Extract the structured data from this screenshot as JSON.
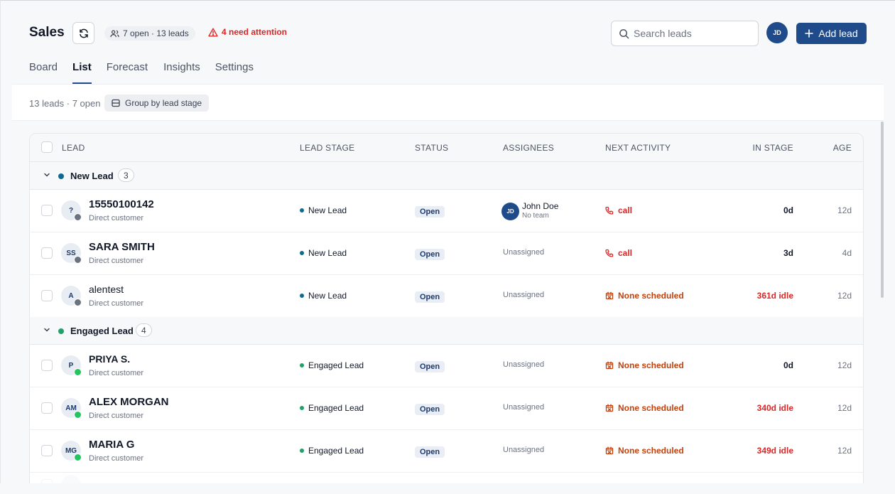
{
  "header": {
    "title": "Sales",
    "pill_text": "7 open · 13 leads",
    "attention_text": "4 need attention",
    "search_placeholder": "Search leads",
    "avatar_initials": "JD",
    "add_button_label": "Add lead"
  },
  "tabs": [
    {
      "label": "Board",
      "active": false
    },
    {
      "label": "List",
      "active": true
    },
    {
      "label": "Forecast",
      "active": false
    },
    {
      "label": "Insights",
      "active": false
    },
    {
      "label": "Settings",
      "active": false
    }
  ],
  "toolbar": {
    "count_text": "13 leads · 7 open",
    "group_label": "Group by lead stage"
  },
  "table": {
    "columns": [
      "LEAD",
      "LEAD STAGE",
      "STATUS",
      "ASSIGNEES",
      "NEXT ACTIVITY",
      "IN STAGE",
      "AGE"
    ],
    "groups": [
      {
        "name": "New Lead",
        "count": "3",
        "color": "#0e6b8f",
        "rows": [
          {
            "initials": "?",
            "name": "15550100142",
            "sub": "Direct customer",
            "source": "web",
            "stage": "New Lead",
            "status": "Open",
            "assignee_initials": "JD",
            "assignee_name": "John Doe",
            "assignee_team": "No team",
            "activity": "call",
            "activity_type": "call",
            "in_stage": "0d",
            "age": "12d"
          },
          {
            "initials": "SS",
            "name": "SARA SMITH",
            "sub": "Direct customer",
            "source": "web",
            "stage": "New Lead",
            "status": "Open",
            "assignee": "Unassigned",
            "activity": "call",
            "activity_type": "call",
            "in_stage": "3d",
            "age": "4d"
          },
          {
            "initials": "A",
            "name": "alentest",
            "sub": "Direct customer",
            "source": "web",
            "stage": "New Lead",
            "status": "Open",
            "assignee": "Unassigned",
            "activity": "None scheduled",
            "activity_type": "none",
            "in_stage": "361d idle",
            "age": "12d"
          }
        ]
      },
      {
        "name": "Engaged Lead",
        "count": "4",
        "color": "#22a06b",
        "rows": [
          {
            "initials": "P",
            "name": "PRIYA S.",
            "sub": "Direct customer",
            "source": "wa",
            "stage": "Engaged Lead",
            "status": "Open",
            "assignee": "Unassigned",
            "activity": "None scheduled",
            "activity_type": "none",
            "in_stage": "0d",
            "age": "12d"
          },
          {
            "initials": "AM",
            "name": "ALEX MORGAN",
            "sub": "Direct customer",
            "source": "wa",
            "stage": "Engaged Lead",
            "status": "Open",
            "assignee": "Unassigned",
            "activity": "None scheduled",
            "activity_type": "none",
            "in_stage": "340d idle",
            "age": "12d"
          },
          {
            "initials": "MG",
            "name": "MARIA G",
            "sub": "Direct customer",
            "source": "wa",
            "stage": "Engaged Lead",
            "status": "Open",
            "assignee": "Unassigned",
            "activity": "None scheduled",
            "activity_type": "none",
            "in_stage": "349d idle",
            "age": "12d"
          }
        ]
      }
    ]
  },
  "colors": {
    "accent": "#1f4b8a",
    "danger": "#dc2626",
    "warning": "#c2410c",
    "new_lead": "#0e6b8f",
    "engaged_lead": "#22a06b"
  }
}
